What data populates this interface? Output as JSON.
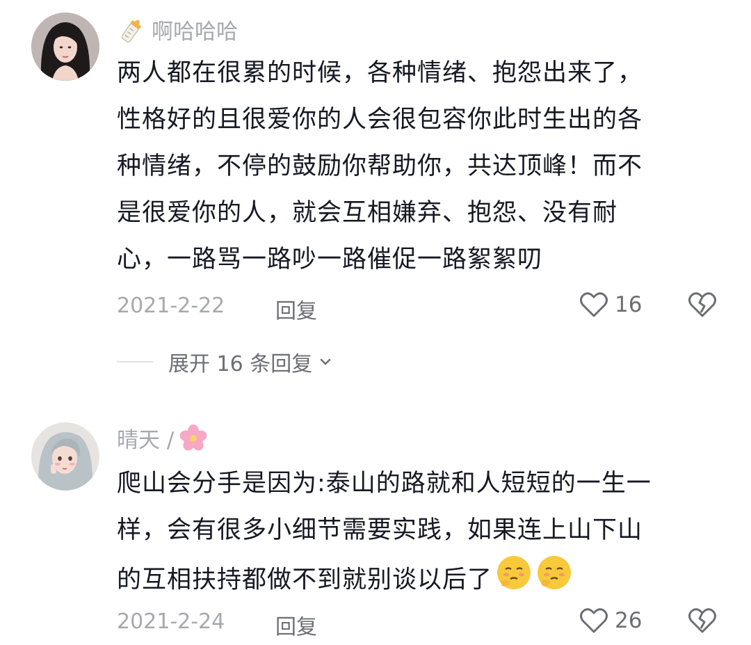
{
  "comments": [
    {
      "username": "啊哈哈哈",
      "username_icon": "baby-bottle-icon",
      "text_lines": [
        "两人都在很累的时候，各种情绪、抱怨出来了，",
        "性格好的且很爱你的人会很包容你此时生出的各",
        "种情绪，不停的鼓励你帮助你，共达顶峰！而不",
        "是很爱你的人，就会互相嫌弃、抱怨、没有耐",
        "心，一路骂一路吵一路催促一路絮絮叨"
      ],
      "date": "2021-2-22",
      "reply_label": "回复",
      "like_count": "16",
      "expand_label": "展开 16 条回复"
    },
    {
      "username": "晴天 /",
      "username_icon": "cherry-blossom-icon",
      "text_lines": [
        "爬山会分手是因为:泰山的路就和人短短的一生一",
        "样，会有很多小细节需要实践，如果连上山下山",
        "的互相扶持都做不到就别谈以后了"
      ],
      "trailing_emojis": [
        "thinking-face-icon",
        "thinking-face-icon"
      ],
      "date": "2021-2-24",
      "reply_label": "回复",
      "like_count": "26"
    }
  ]
}
